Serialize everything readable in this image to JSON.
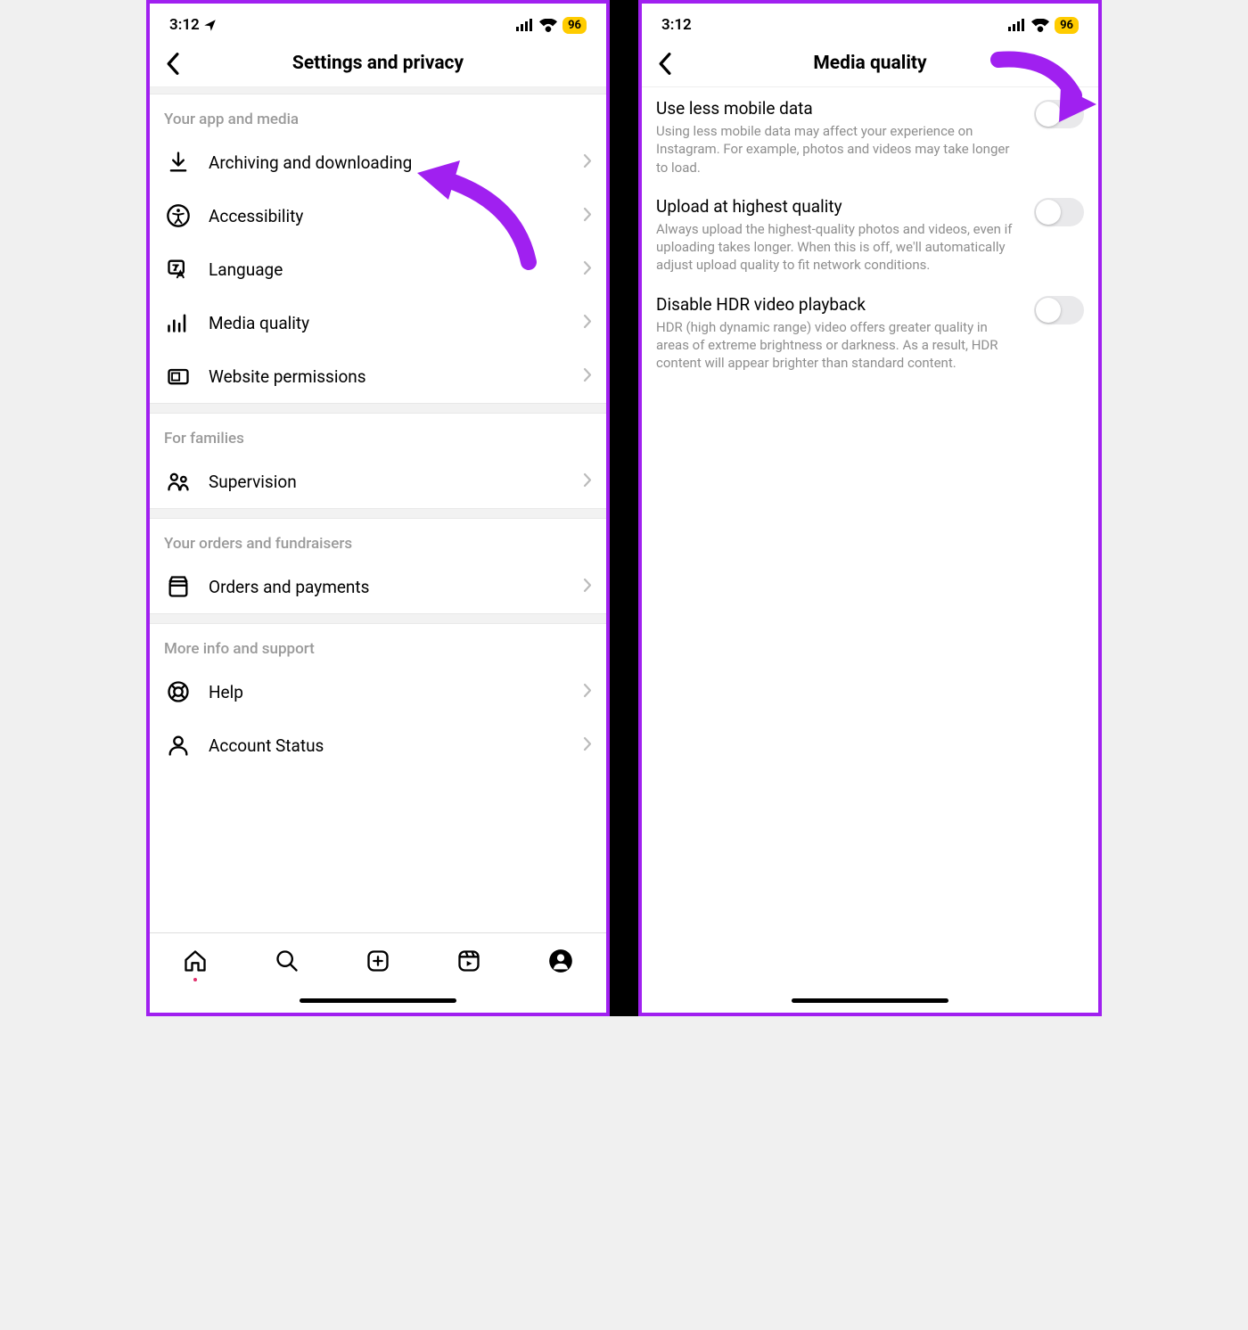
{
  "status": {
    "time": "3:12",
    "battery": "96"
  },
  "left": {
    "title": "Settings and privacy",
    "sections": [
      {
        "header": "Your app and media",
        "items": [
          {
            "label": "Archiving and downloading",
            "icon": "download"
          },
          {
            "label": "Accessibility",
            "icon": "accessibility"
          },
          {
            "label": "Language",
            "icon": "language"
          },
          {
            "label": "Media quality",
            "icon": "media-quality"
          },
          {
            "label": "Website permissions",
            "icon": "website"
          }
        ]
      },
      {
        "header": "For families",
        "items": [
          {
            "label": "Supervision",
            "icon": "supervision"
          }
        ]
      },
      {
        "header": "Your orders and fundraisers",
        "items": [
          {
            "label": "Orders and payments",
            "icon": "orders"
          }
        ]
      },
      {
        "header": "More info and support",
        "items": [
          {
            "label": "Help",
            "icon": "help"
          },
          {
            "label": "Account Status",
            "icon": "account"
          }
        ]
      }
    ]
  },
  "right": {
    "title": "Media quality",
    "toggles": [
      {
        "title": "Use less mobile data",
        "desc": "Using less mobile data may affect your experience on Instagram. For example, photos and videos may take longer to load.",
        "on": false
      },
      {
        "title": "Upload at highest quality",
        "desc": "Always upload the highest-quality photos and videos, even if uploading takes longer. When this is off, we'll automatically adjust upload quality to fit network conditions.",
        "on": false
      },
      {
        "title": "Disable HDR video playback",
        "desc": "HDR (high dynamic range) video offers greater quality in areas of extreme brightness or darkness. As a result, HDR content will appear brighter than standard content.",
        "on": false
      }
    ]
  }
}
